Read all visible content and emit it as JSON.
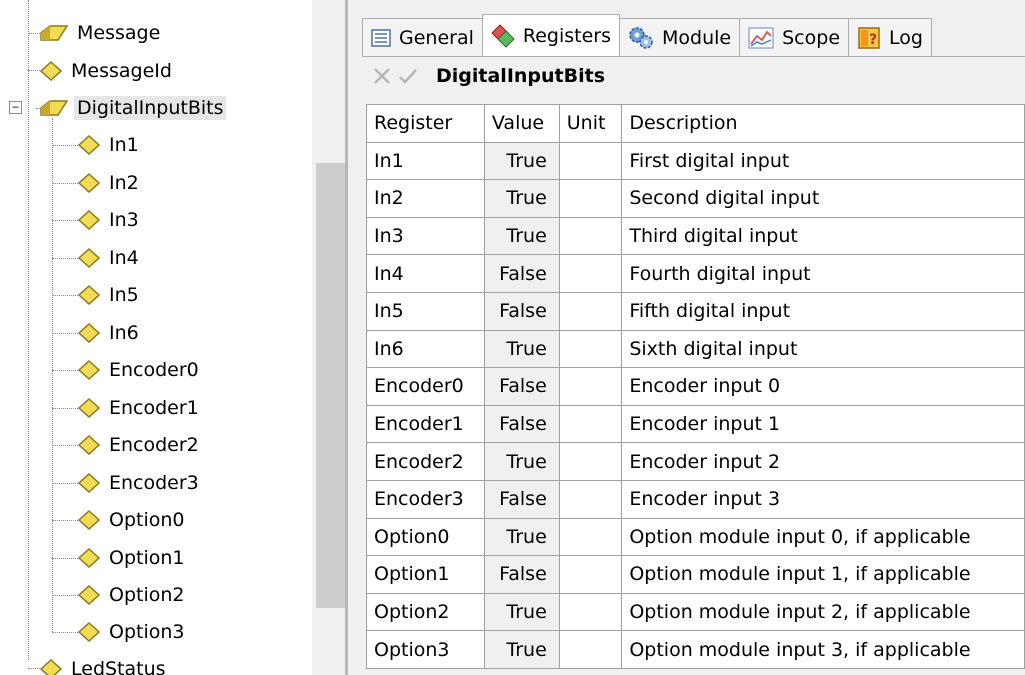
{
  "tree": {
    "nodes": [
      {
        "label": "Message"
      },
      {
        "label": "MessageId"
      },
      {
        "label": "DigitalInputBits",
        "expander": "−"
      },
      {
        "label": "In1"
      },
      {
        "label": "In2"
      },
      {
        "label": "In3"
      },
      {
        "label": "In4"
      },
      {
        "label": "In5"
      },
      {
        "label": "In6"
      },
      {
        "label": "Encoder0"
      },
      {
        "label": "Encoder1"
      },
      {
        "label": "Encoder2"
      },
      {
        "label": "Encoder3"
      },
      {
        "label": "Option0"
      },
      {
        "label": "Option1"
      },
      {
        "label": "Option2"
      },
      {
        "label": "Option3"
      },
      {
        "label": "LedStatus"
      }
    ]
  },
  "tabs": [
    {
      "label": "General",
      "icon": "list-icon"
    },
    {
      "label": "Registers",
      "icon": "register-icon"
    },
    {
      "label": "Module",
      "icon": "gears-icon"
    },
    {
      "label": "Scope",
      "icon": "chart-icon"
    },
    {
      "label": "Log",
      "icon": "log-icon"
    }
  ],
  "toolbar": {
    "title": "DigitalInputBits",
    "cancel_icon": "close-icon",
    "apply_icon": "check-icon"
  },
  "grid": {
    "headers": [
      "Register",
      "Value",
      "Unit",
      "Description"
    ],
    "rows": [
      {
        "register": "In1",
        "value": "True",
        "unit": "",
        "description": "First digital input"
      },
      {
        "register": "In2",
        "value": "True",
        "unit": "",
        "description": "Second digital input"
      },
      {
        "register": "In3",
        "value": "True",
        "unit": "",
        "description": "Third digital input"
      },
      {
        "register": "In4",
        "value": "False",
        "unit": "",
        "description": "Fourth digital input"
      },
      {
        "register": "In5",
        "value": "False",
        "unit": "",
        "description": "Fifth digital input"
      },
      {
        "register": "In6",
        "value": "True",
        "unit": "",
        "description": "Sixth digital input"
      },
      {
        "register": "Encoder0",
        "value": "False",
        "unit": "",
        "description": "Encoder input 0"
      },
      {
        "register": "Encoder1",
        "value": "False",
        "unit": "",
        "description": "Encoder input 1"
      },
      {
        "register": "Encoder2",
        "value": "True",
        "unit": "",
        "description": "Encoder input 2"
      },
      {
        "register": "Encoder3",
        "value": "False",
        "unit": "",
        "description": "Encoder input 3"
      },
      {
        "register": "Option0",
        "value": "True",
        "unit": "",
        "description": "Option module input 0, if applicable"
      },
      {
        "register": "Option1",
        "value": "False",
        "unit": "",
        "description": "Option module input 1, if applicable"
      },
      {
        "register": "Option2",
        "value": "True",
        "unit": "",
        "description": "Option module input 2, if applicable"
      },
      {
        "register": "Option3",
        "value": "True",
        "unit": "",
        "description": "Option module input 3, if applicable"
      }
    ]
  },
  "colors": {
    "diamond_fill": "#f2dc57",
    "diamond_stroke": "#8a7a1c",
    "value_cell_bg": "#f0f0f0",
    "panel_bg": "#f0f0f0"
  }
}
